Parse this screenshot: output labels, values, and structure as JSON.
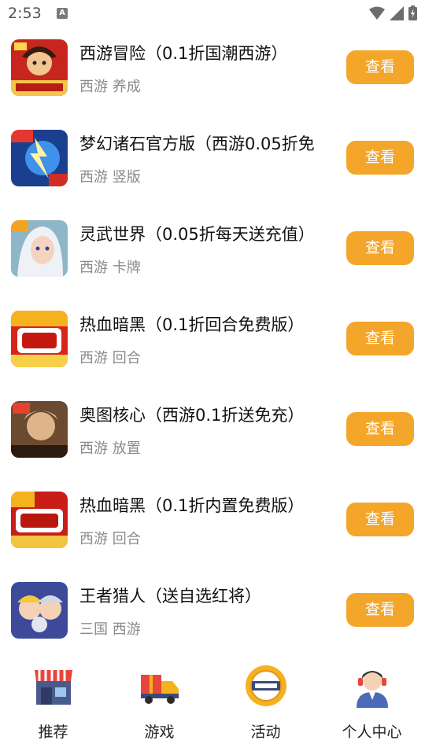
{
  "status_bar": {
    "time": "2:53",
    "notification_glyph": "A"
  },
  "games": [
    {
      "title": "西游冒险（0.1折国潮西游）",
      "tags": "西游 养成",
      "button": "查看",
      "icon": "game-icon-red-warrior"
    },
    {
      "title": "梦幻诸石官方版（西游0.05折免",
      "tags": "西游 竖版",
      "button": "查看",
      "icon": "game-icon-blue-lightning"
    },
    {
      "title": "灵武世界（0.05折每天送充值）",
      "tags": "西游 卡牌",
      "button": "查看",
      "icon": "game-icon-white-hair-girl"
    },
    {
      "title": "热血暗黑（0.1折回合免费版）",
      "tags": "西游 回合",
      "button": "查看",
      "icon": "game-icon-xiyou-red"
    },
    {
      "title": "奥图核心（西游0.1折送免充）",
      "tags": "西游 放置",
      "button": "查看",
      "icon": "game-icon-warrior-portrait"
    },
    {
      "title": "热血暗黑（0.1折内置免费版）",
      "tags": "西游 回合",
      "button": "查看",
      "icon": "game-icon-xiyou-red"
    },
    {
      "title": "王者猎人（送自选红将）",
      "tags": "三国 西游",
      "button": "查看",
      "icon": "game-icon-hunter-duo"
    }
  ],
  "tabs": [
    {
      "label": "推荐",
      "icon": "store-icon"
    },
    {
      "label": "游戏",
      "icon": "gift-truck-icon"
    },
    {
      "label": "活动",
      "icon": "sale-badge-icon"
    },
    {
      "label": "个人中心",
      "icon": "support-agent-icon"
    }
  ],
  "colors": {
    "button": "#f4a62a",
    "title": "#111111",
    "tags": "#8a8a8a"
  }
}
